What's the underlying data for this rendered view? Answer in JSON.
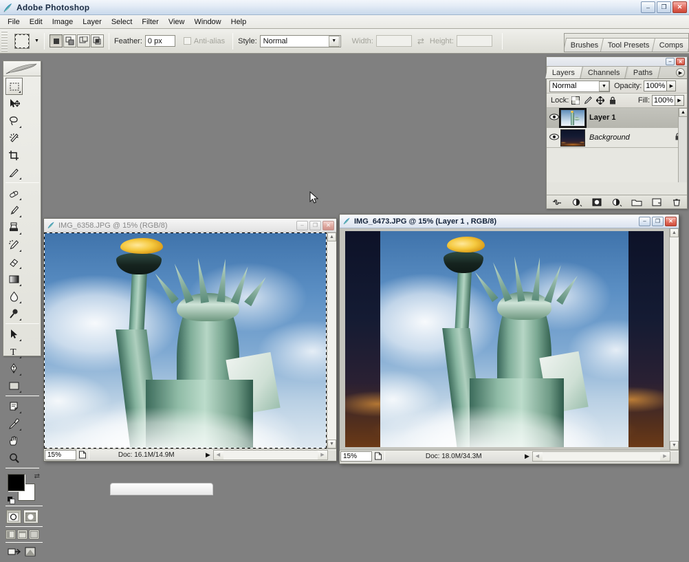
{
  "app": {
    "title": "Adobe Photoshop",
    "icon": "photoshop-icon",
    "window_buttons": {
      "minimize": "–",
      "restore": "❐",
      "close": "✕"
    }
  },
  "menubar": {
    "items": [
      {
        "label": "File"
      },
      {
        "label": "Edit"
      },
      {
        "label": "Image"
      },
      {
        "label": "Layer"
      },
      {
        "label": "Select"
      },
      {
        "label": "Filter"
      },
      {
        "label": "View"
      },
      {
        "label": "Window"
      },
      {
        "label": "Help"
      }
    ]
  },
  "options_bar": {
    "tool_preset_name": "rectangular-marquee-tool",
    "selection_modes": [
      "new-selection",
      "add-to-selection",
      "subtract-from-selection",
      "intersect-with-selection"
    ],
    "feather_label": "Feather:",
    "feather_value": "0 px",
    "antialias_label": "Anti-alias",
    "antialias_checked": false,
    "style_label": "Style:",
    "style_value": "Normal",
    "width_label": "Width:",
    "width_value": "",
    "height_label": "Height:",
    "height_value": "",
    "swap_icon": "swap-arrows-icon",
    "imageready_label": "edit-in-imageready-icon"
  },
  "palette_well": {
    "tabs": [
      {
        "label": "Brushes"
      },
      {
        "label": "Tool Presets"
      },
      {
        "label": "Comps"
      }
    ]
  },
  "toolbox": {
    "tools": [
      {
        "name": "rectangular-marquee-tool",
        "glyph": "marquee",
        "selected": true,
        "has_flyout": true
      },
      {
        "name": "move-tool",
        "glyph": "move",
        "selected": false,
        "has_flyout": false
      },
      {
        "name": "lasso-tool",
        "glyph": "lasso",
        "selected": false,
        "has_flyout": true
      },
      {
        "name": "magic-wand-tool",
        "glyph": "wand",
        "selected": false,
        "has_flyout": false
      },
      {
        "name": "crop-tool",
        "glyph": "crop",
        "selected": false,
        "has_flyout": false
      },
      {
        "name": "slice-tool",
        "glyph": "slice",
        "selected": false,
        "has_flyout": true
      },
      {
        "name": "healing-brush-tool",
        "glyph": "heal",
        "selected": false,
        "has_flyout": true
      },
      {
        "name": "brush-tool",
        "glyph": "brush",
        "selected": false,
        "has_flyout": true
      },
      {
        "name": "clone-stamp-tool",
        "glyph": "stamp",
        "selected": false,
        "has_flyout": true
      },
      {
        "name": "history-brush-tool",
        "glyph": "history",
        "selected": false,
        "has_flyout": true
      },
      {
        "name": "eraser-tool",
        "glyph": "eraser",
        "selected": false,
        "has_flyout": true
      },
      {
        "name": "gradient-tool",
        "glyph": "gradient",
        "selected": false,
        "has_flyout": true
      },
      {
        "name": "blur-tool",
        "glyph": "blur",
        "selected": false,
        "has_flyout": true
      },
      {
        "name": "dodge-tool",
        "glyph": "dodge",
        "selected": false,
        "has_flyout": true
      },
      {
        "name": "path-selection-tool",
        "glyph": "pathsel",
        "selected": false,
        "has_flyout": true
      },
      {
        "name": "type-tool",
        "glyph": "type",
        "selected": false,
        "has_flyout": true
      },
      {
        "name": "pen-tool",
        "glyph": "pen",
        "selected": false,
        "has_flyout": true
      },
      {
        "name": "rectangle-shape-tool",
        "glyph": "shape",
        "selected": false,
        "has_flyout": true
      },
      {
        "name": "notes-tool",
        "glyph": "notes",
        "selected": false,
        "has_flyout": true
      },
      {
        "name": "eyedropper-tool",
        "glyph": "eyedrop",
        "selected": false,
        "has_flyout": true
      },
      {
        "name": "hand-tool",
        "glyph": "hand",
        "selected": false,
        "has_flyout": false
      },
      {
        "name": "zoom-tool",
        "glyph": "zoom",
        "selected": false,
        "has_flyout": false
      }
    ],
    "foreground_color": "#000000",
    "background_color": "#ffffff",
    "quickmask_modes": [
      "standard-mode",
      "quick-mask-mode"
    ],
    "screen_modes": [
      "standard-screen-mode",
      "full-screen-with-menubar",
      "full-screen-mode"
    ],
    "jump_to": [
      "edit-in-imageready-icon"
    ]
  },
  "layers_palette": {
    "window_buttons": {
      "minimize": "–",
      "close": "✕"
    },
    "tabs": [
      {
        "label": "Layers",
        "active": true
      },
      {
        "label": "Channels",
        "active": false
      },
      {
        "label": "Paths",
        "active": false
      }
    ],
    "menu_icon": "palette-menu-icon",
    "blend_mode": "Normal",
    "opacity_label": "Opacity:",
    "opacity_value": "100%",
    "lock_label": "Lock:",
    "lock_icons": [
      "lock-transparency-icon",
      "lock-image-icon",
      "lock-position-icon",
      "lock-all-icon"
    ],
    "fill_label": "Fill:",
    "fill_value": "100%",
    "layers": [
      {
        "name": "Layer 1",
        "visible": true,
        "selected": true,
        "locked": false,
        "italic": false,
        "thumb": "statue-day"
      },
      {
        "name": "Background",
        "visible": true,
        "selected": false,
        "locked": true,
        "italic": true,
        "thumb": "night-skyline"
      }
    ],
    "footer_buttons": [
      {
        "name": "link-layers-button",
        "glyph": "⛓"
      },
      {
        "name": "layer-style-button",
        "glyph": "◑"
      },
      {
        "name": "layer-mask-button",
        "glyph": "◙"
      },
      {
        "name": "adjustment-layer-button",
        "glyph": "◑"
      },
      {
        "name": "new-group-button",
        "glyph": "▭"
      },
      {
        "name": "new-layer-button",
        "glyph": "▣"
      },
      {
        "name": "delete-layer-button",
        "glyph": "🗑"
      }
    ]
  },
  "documents": [
    {
      "id": "doc-img-6358",
      "title": "IMG_6358.JPG @ 15% (RGB/8)",
      "active": false,
      "zoom": "15%",
      "doc_size": "Doc: 16.1M/14.9M",
      "has_selection": true,
      "image": "statue-of-liberty-day",
      "window_buttons": {
        "minimize": "–",
        "restore": "❐",
        "close": "✕"
      }
    },
    {
      "id": "doc-img-6473",
      "title": "IMG_6473.JPG @ 15% (Layer 1 , RGB/8)",
      "active": true,
      "zoom": "15%",
      "doc_size": "Doc: 18.0M/34.3M",
      "has_selection": false,
      "image": "statue-over-night-skyline",
      "window_buttons": {
        "minimize": "–",
        "restore": "❐",
        "close": "✕"
      }
    }
  ],
  "colors": {
    "desktop": "#808080",
    "titlebar_accent": "#d6e2f0",
    "close_button": "#cd4637",
    "sky_blue": "#5b8fc4",
    "statue_green": "#8ab8a4",
    "torch_gold": "#f5c93f",
    "night_navy": "#141b33"
  }
}
